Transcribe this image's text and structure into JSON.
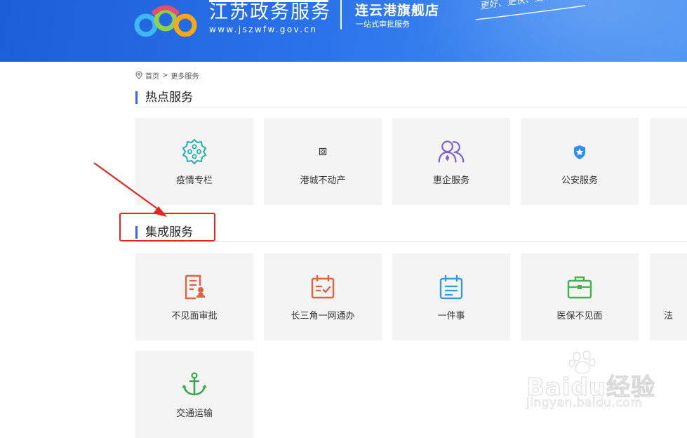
{
  "header": {
    "site_title": "江苏政务服务",
    "site_url": "www.jszwfw.gov.cn",
    "store_name": "连云港旗舰店",
    "store_subtitle": "一站式审批服务",
    "slogan": "更好、更快、更细心"
  },
  "breadcrumb": {
    "home": "首页",
    "separator": ">",
    "current": "更多服务"
  },
  "sections": {
    "hot": {
      "title": "热点服务",
      "items": [
        {
          "label": "疫情专栏",
          "icon": "gear-cluster-icon"
        },
        {
          "label": "港城不动产",
          "icon": "broken-image-icon"
        },
        {
          "label": "惠企服务",
          "icon": "people-icon"
        },
        {
          "label": "公安服务",
          "icon": "police-shield-icon"
        }
      ]
    },
    "integrated": {
      "title": "集成服务",
      "items": [
        {
          "label": "不见面审批",
          "icon": "document-stamp-icon"
        },
        {
          "label": "长三角一网通办",
          "icon": "calendar-check-icon"
        },
        {
          "label": "一件事",
          "icon": "calendar-list-icon"
        },
        {
          "label": "医保不见面",
          "icon": "medical-briefcase-icon"
        },
        {
          "label": "交通运输",
          "icon": "anchor-icon"
        }
      ],
      "partial_label_glyph": "法"
    }
  },
  "watermark": {
    "brand": "Baidu经验",
    "url": "jingyan.baidu.com"
  },
  "colors": {
    "header_blue": "#2a72ea",
    "accent_blue": "#2b6fe6",
    "annotation_red": "#e8261d",
    "card_bg": "#f4f4f4"
  }
}
